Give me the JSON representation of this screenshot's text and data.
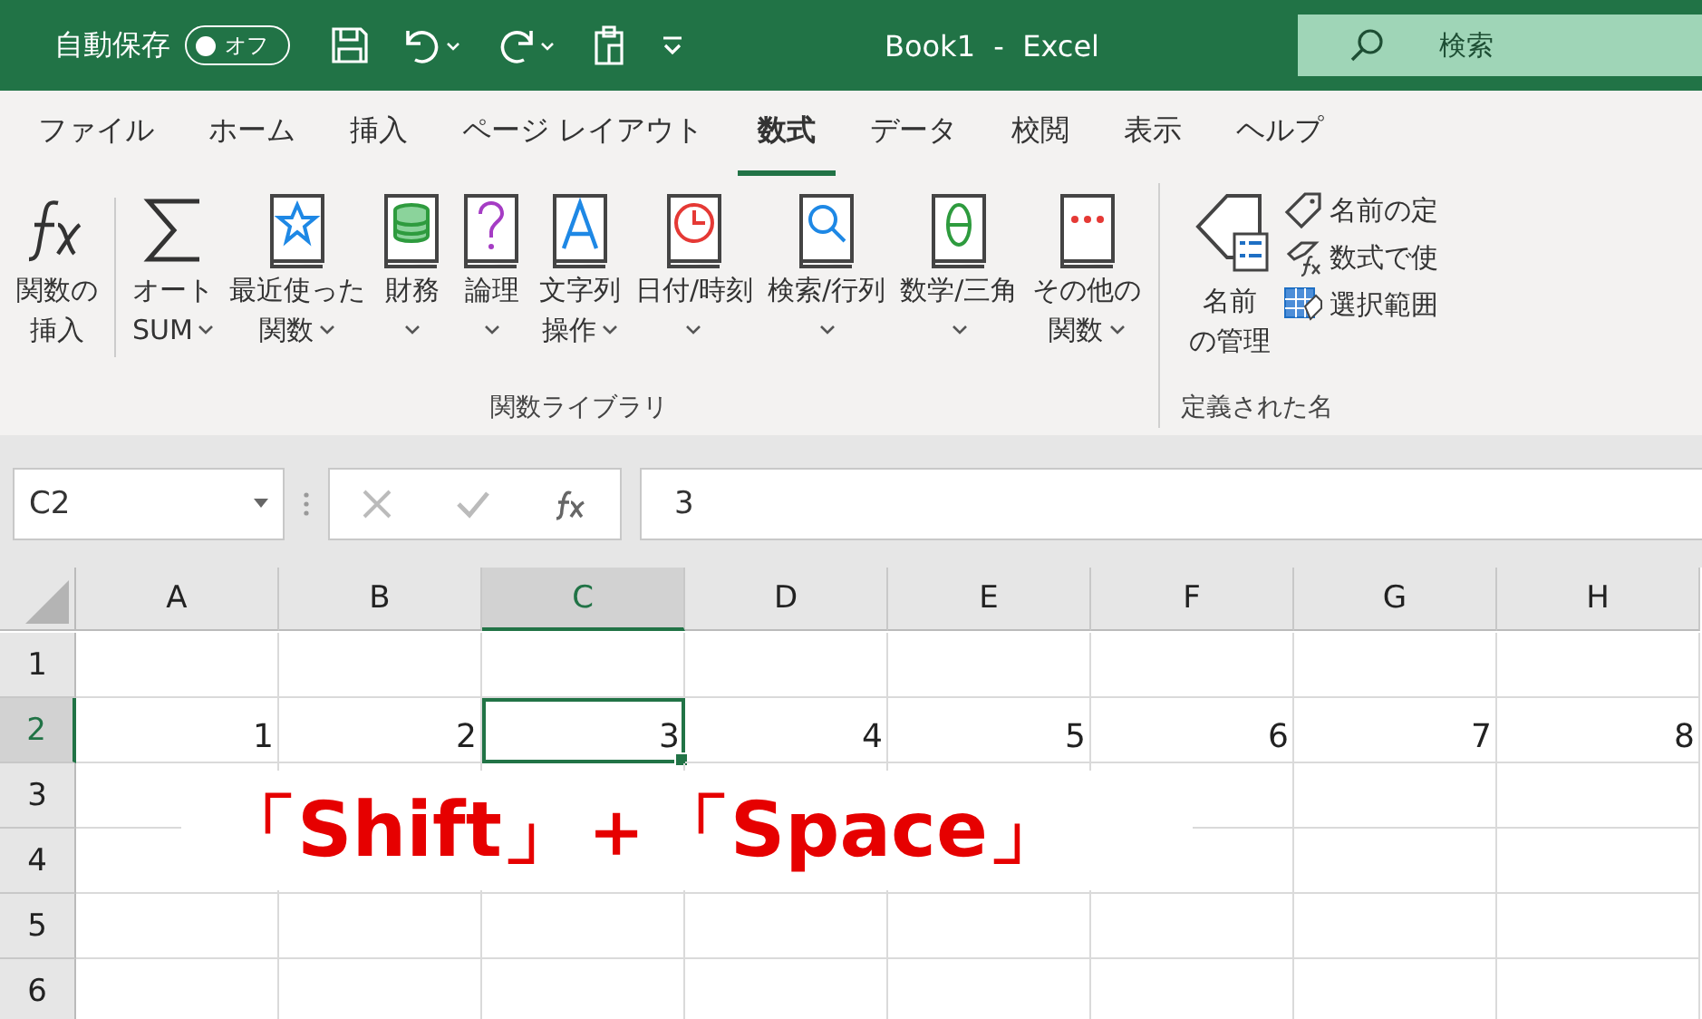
{
  "title_bar": {
    "autosave_label": "自動保存",
    "autosave_toggle": {
      "label": "オフ",
      "on": false
    },
    "title": "Book1  -  Excel",
    "search": {
      "placeholder": "検索"
    }
  },
  "tabs": [
    {
      "label": "ファイル",
      "selected": false
    },
    {
      "label": "ホーム",
      "selected": false
    },
    {
      "label": "挿入",
      "selected": false
    },
    {
      "label": "ページ レイアウト",
      "selected": false
    },
    {
      "label": "数式",
      "selected": true
    },
    {
      "label": "データ",
      "selected": false
    },
    {
      "label": "校閲",
      "selected": false
    },
    {
      "label": "表示",
      "selected": false
    },
    {
      "label": "ヘルプ",
      "selected": false
    }
  ],
  "ribbon": {
    "groups": [
      {
        "label": "関数ライブラリ",
        "buttons": [
          {
            "kind": "fx",
            "lines": [
              "関数の",
              "挿入"
            ],
            "dropdown": false
          },
          {
            "kind": "sigma",
            "lines": [
              "オート",
              "SUM"
            ],
            "dropdown": true
          },
          {
            "kind": "star",
            "lines": [
              "最近使った",
              "関数"
            ],
            "dropdown": true
          },
          {
            "kind": "database",
            "lines": [
              "財務"
            ],
            "dropdown": true
          },
          {
            "kind": "question",
            "lines": [
              "論理"
            ],
            "dropdown": true
          },
          {
            "kind": "letter",
            "lines": [
              "文字列",
              "操作"
            ],
            "dropdown": true
          },
          {
            "kind": "clock",
            "lines": [
              "日付/時刻"
            ],
            "dropdown": true
          },
          {
            "kind": "search",
            "lines": [
              "検索/行列"
            ],
            "dropdown": true
          },
          {
            "kind": "theta",
            "lines": [
              "数学/三角"
            ],
            "dropdown": true
          },
          {
            "kind": "dots",
            "lines": [
              "その他の",
              "関数"
            ],
            "dropdown": true
          }
        ]
      },
      {
        "label": "定義された名",
        "buttons": [
          {
            "kind": "manager",
            "lines": [
              "名前",
              "の管理"
            ],
            "dropdown": false
          }
        ],
        "small_buttons": [
          {
            "kind": "tag",
            "label": "名前の定"
          },
          {
            "kind": "fxtag",
            "label": "数式で使"
          },
          {
            "kind": "gridtag",
            "label": "選択範囲"
          }
        ]
      }
    ]
  },
  "formula_bar": {
    "name_box": "C2",
    "value": "3"
  },
  "sheet": {
    "columns": [
      {
        "label": "A",
        "selected": false
      },
      {
        "label": "B",
        "selected": false
      },
      {
        "label": "C",
        "selected": true
      },
      {
        "label": "D",
        "selected": false
      },
      {
        "label": "E",
        "selected": false
      },
      {
        "label": "F",
        "selected": false
      },
      {
        "label": "G",
        "selected": false
      },
      {
        "label": "H",
        "selected": false
      }
    ],
    "rows": [
      {
        "header": "1",
        "selected": false,
        "cells": []
      },
      {
        "header": "2",
        "selected": true,
        "cells": [
          "1",
          "2",
          "3",
          "4",
          "5",
          "6",
          "7",
          "8"
        ]
      },
      {
        "header": "3",
        "selected": false,
        "cells": []
      },
      {
        "header": "4",
        "selected": false,
        "cells": []
      },
      {
        "header": "5",
        "selected": false,
        "cells": []
      },
      {
        "header": "6",
        "selected": false,
        "cells": []
      }
    ]
  },
  "caption": "「Shift」＋「Space」"
}
